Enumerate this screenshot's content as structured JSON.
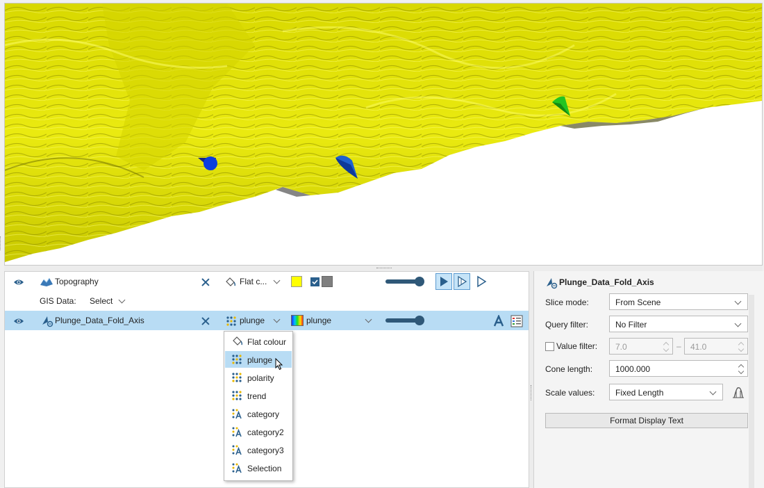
{
  "layers": {
    "topography": {
      "name": "Topography",
      "colour_mode": "Flat c...",
      "flat_colour": "#ffff00",
      "backface_colour": "#7f7f7f",
      "gis_label": "GIS Data:",
      "gis_value": "Select"
    },
    "plunge": {
      "name": "Plunge_Data_Fold_Axis",
      "colour_mode": "plunge",
      "colourmap_attribute": "plunge"
    }
  },
  "colour_menu": {
    "items": [
      {
        "label": "Flat colour",
        "icon": "paint-bucket-icon"
      },
      {
        "label": "plunge",
        "icon": "numeric-attribute-icon"
      },
      {
        "label": "polarity",
        "icon": "numeric-attribute-icon"
      },
      {
        "label": "trend",
        "icon": "numeric-attribute-icon"
      },
      {
        "label": "category",
        "icon": "category-attribute-icon"
      },
      {
        "label": "category2",
        "icon": "category-attribute-icon"
      },
      {
        "label": "category3",
        "icon": "category-attribute-icon"
      },
      {
        "label": "Selection",
        "icon": "category-attribute-icon"
      }
    ],
    "highlighted": "plunge"
  },
  "properties": {
    "title": "Plunge_Data_Fold_Axis",
    "slice_mode_label": "Slice mode:",
    "slice_mode_value": "From Scene",
    "query_filter_label": "Query filter:",
    "query_filter_value": "No Filter",
    "value_filter_label": "Value filter:",
    "value_filter_min": "7.0",
    "value_filter_sep": "–",
    "value_filter_max": "41.0",
    "cone_length_label": "Cone length:",
    "cone_length_value": "1000.000",
    "scale_values_label": "Scale values:",
    "scale_values_value": "Fixed Length",
    "format_button": "Format Display Text"
  },
  "colors": {
    "surface": "#e8e800",
    "surface_shadow": "#7a7a00",
    "selection": "#b8dcf4",
    "accent": "#2f5878"
  }
}
